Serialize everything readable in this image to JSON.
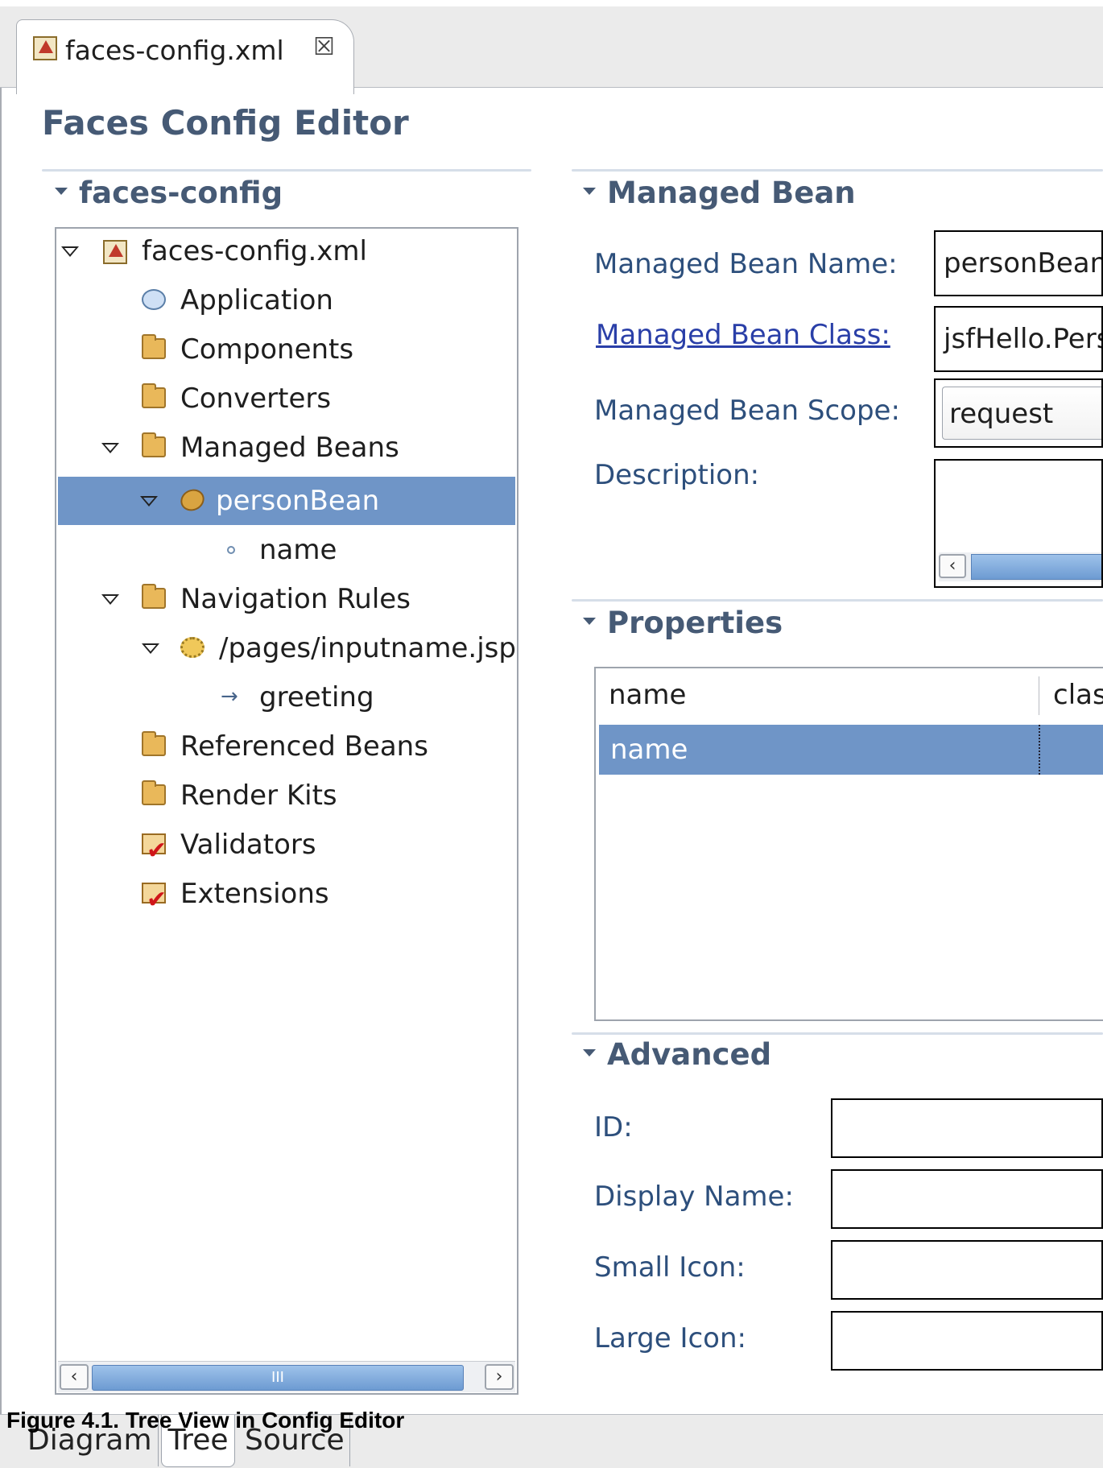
{
  "editor_tab": {
    "label": "faces-config.xml",
    "close_glyph": "☒"
  },
  "editor_title": "Faces Config Editor",
  "tree_section": {
    "title": "faces-config",
    "items": [
      {
        "label": "faces-config.xml",
        "icon": "xml-file-icon"
      },
      {
        "label": "Application",
        "icon": "application-icon"
      },
      {
        "label": "Components",
        "icon": "components-folder-icon"
      },
      {
        "label": "Converters",
        "icon": "converters-folder-icon"
      },
      {
        "label": "Managed Beans",
        "icon": "managed-beans-folder-icon"
      },
      {
        "label": "personBean",
        "icon": "bean-icon"
      },
      {
        "label": "name",
        "icon": "property-dot-icon"
      },
      {
        "label": "Navigation Rules",
        "icon": "navigation-folder-icon"
      },
      {
        "label": "/pages/inputname.jsp",
        "icon": "gear-icon"
      },
      {
        "label": "greeting",
        "icon": "arrow-icon"
      },
      {
        "label": "Referenced Beans",
        "icon": "referenced-beans-folder-icon"
      },
      {
        "label": "Render Kits",
        "icon": "render-kits-folder-icon"
      },
      {
        "label": "Validators",
        "icon": "validators-check-icon"
      },
      {
        "label": "Extensions",
        "icon": "extensions-check-icon"
      }
    ],
    "scrollbar_grip": "III"
  },
  "managed_bean_section": {
    "title": "Managed Bean",
    "name_label": "Managed Bean Name:",
    "name_value": "personBean",
    "class_label": "Managed Bean Class:",
    "class_value": "jsfHello.PersonBean",
    "scope_label": "Managed Bean Scope:",
    "scope_value": "request",
    "description_label": "Description:",
    "description_value": ""
  },
  "properties_section": {
    "title": "Properties",
    "columns": [
      "name",
      "class"
    ],
    "rows": [
      {
        "name": "name",
        "class": ""
      }
    ]
  },
  "advanced_section": {
    "title": "Advanced",
    "id_label": "ID:",
    "display_name_label": "Display Name:",
    "small_icon_label": "Small Icon:",
    "large_icon_label": "Large Icon:"
  },
  "bottom_tabs": [
    "Diagram",
    "Tree",
    "Source"
  ],
  "figure_caption": "Figure 4.1. Tree View in Config Editor",
  "colors": {
    "heading": "#465a75",
    "label": "#2d4f7c",
    "selection": "#6f95c7"
  }
}
